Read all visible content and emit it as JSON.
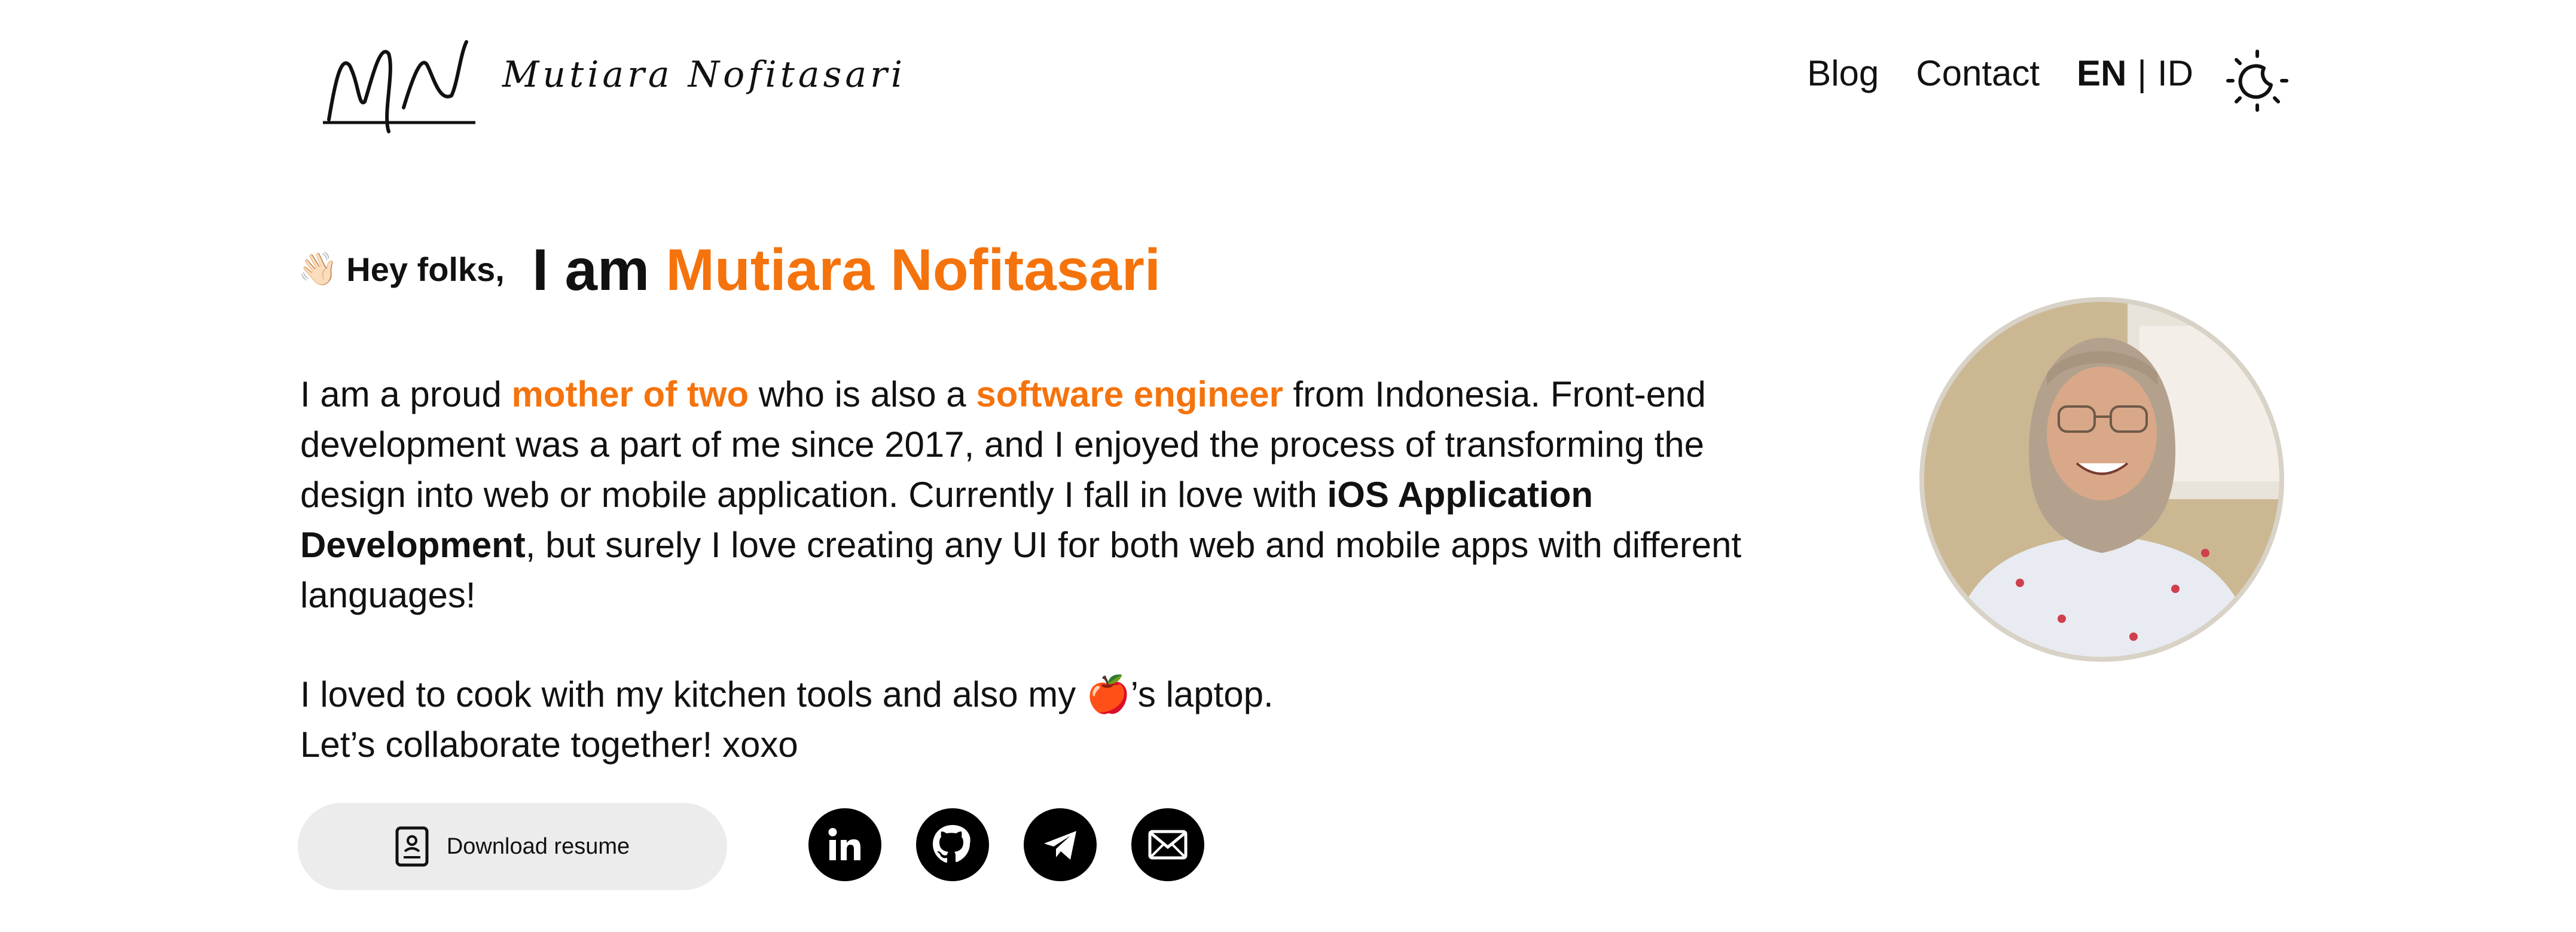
{
  "header": {
    "logo_text": "Mutiara Nofitasari",
    "nav": [
      {
        "label": "Blog"
      },
      {
        "label": "Contact"
      }
    ],
    "lang": {
      "active": "EN",
      "separator": "|",
      "other": "ID"
    }
  },
  "hero": {
    "wave_emoji": "👋🏻",
    "hey": "Hey folks,",
    "iam_prefix": "I am ",
    "name": "Mutiara Nofitasari"
  },
  "bio": {
    "p1_a": "I am a proud ",
    "p1_hl1": "mother of two",
    "p1_b": " who is also a ",
    "p1_hl2": "software engineer",
    "p1_c": " from Indonesia. Front-end development was a part of me since 2017, and I enjoyed the process of transforming the design into web or mobile application. Currently I fall in love with ",
    "p1_bold": "iOS Application Development",
    "p1_d": ", but surely I love creating any UI for both web and mobile apps with different languages!",
    "p2_a": "I loved to cook with my kitchen tools and also my ",
    "p2_apple": "🍎",
    "p2_b": "’s laptop.",
    "p3": "Let’s collaborate together! xoxo"
  },
  "actions": {
    "resume_label": "Download resume",
    "socials": [
      {
        "icon": "linkedin-icon"
      },
      {
        "icon": "github-icon"
      },
      {
        "icon": "telegram-icon"
      },
      {
        "icon": "email-icon"
      }
    ]
  },
  "colors": {
    "accent": "#f5730c",
    "button_bg": "#ececec",
    "social_bg": "#000000"
  }
}
